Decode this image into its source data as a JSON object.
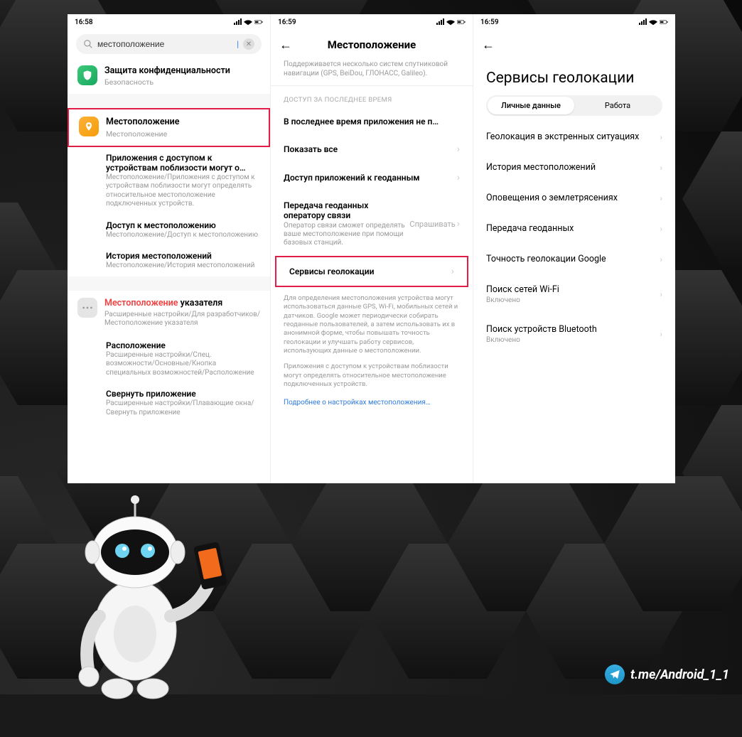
{
  "watermark": "t.me/Android_1_1",
  "screen1": {
    "time": "16:58",
    "search": {
      "value": "местоположение"
    },
    "items": [
      {
        "icon": "green",
        "title": "Защита конфиденциальности",
        "subtitle": "Безопасность"
      },
      {
        "icon": "orange",
        "title": "Местоположение",
        "subtitle": "Местоположение",
        "highlight": true
      }
    ],
    "sub": [
      {
        "title": "Приложения с доступом к устройствам поблизости могут о…",
        "desc": "Местоположение/Приложения с доступом к устройствам поблизости могут определять относительное местоположение подключенных устройств."
      },
      {
        "title": "Доступ к местоположению",
        "desc": "Местоположение/Доступ к местоположению"
      },
      {
        "title": "История местоположений",
        "desc": "Местоположение/История местоположений"
      }
    ],
    "more": [
      {
        "icon": "gray",
        "titleRed": "Местоположение",
        "titleRest": " указателя",
        "desc": "Расширенные настройки/Для разработчиков/Местоположение указателя"
      },
      {
        "title": "Расположение",
        "desc": "Расширенные настройки/Спец. возможности/Основные/Кнопка специальных возможностей/Расположение"
      },
      {
        "title": "Свернуть приложение",
        "desc": "Расширенные настройки/Плавающие окна/Свернуть приложение"
      }
    ]
  },
  "screen2": {
    "time": "16:59",
    "title": "Местоположение",
    "subhead": "Поддерживается несколько систем спутниковой навигации (GPS, BeiDou, ГЛОНАСС, Galileo).",
    "sectionLabel": "ДОСТУП ЗА ПОСЛЕДНЕЕ ВРЕМЯ",
    "rows": [
      {
        "label": "В последнее время приложения не п…"
      },
      {
        "label": "Показать все",
        "arrow": true
      },
      {
        "label": "Доступ приложений к геоданным",
        "arrow": true
      }
    ],
    "carrier": {
      "label": "Передача геоданных оператору связи",
      "sub": "Оператор связи сможет определять ваше местоположение при помощи базовых станций.",
      "value": "Спрашивать"
    },
    "services": {
      "label": "Сервисы геолокации",
      "highlight": true
    },
    "info1": "Для определения местоположения устройства могут использоваться данные GPS, Wi-Fi, мобильных сетей и датчиков. Google может периодически собирать геоданные пользователей, а затем использовать их в анонимной форме, чтобы повышать точность геолокации и улучшать работу сервисов, использующих данные о местоположении.",
    "info2": "Приложения с доступом к устройствам поблизости могут определять относительное местоположение подключенных устройств.",
    "link": "Подробнее о настройках местоположения…"
  },
  "screen3": {
    "time": "16:59",
    "title": "Сервисы геолокации",
    "tabs": {
      "a": "Личные данные",
      "b": "Работа"
    },
    "rows": [
      {
        "label": "Геолокация в экстренных ситуациях"
      },
      {
        "label": "История местоположений"
      },
      {
        "label": "Оповещения о землетрясениях"
      },
      {
        "label": "Передача геоданных"
      },
      {
        "label": "Точность геолокации Google"
      },
      {
        "label": "Поиск сетей Wi-Fi",
        "sub": "Включено"
      },
      {
        "label": "Поиск устройств Bluetooth",
        "sub": "Включено"
      }
    ]
  }
}
